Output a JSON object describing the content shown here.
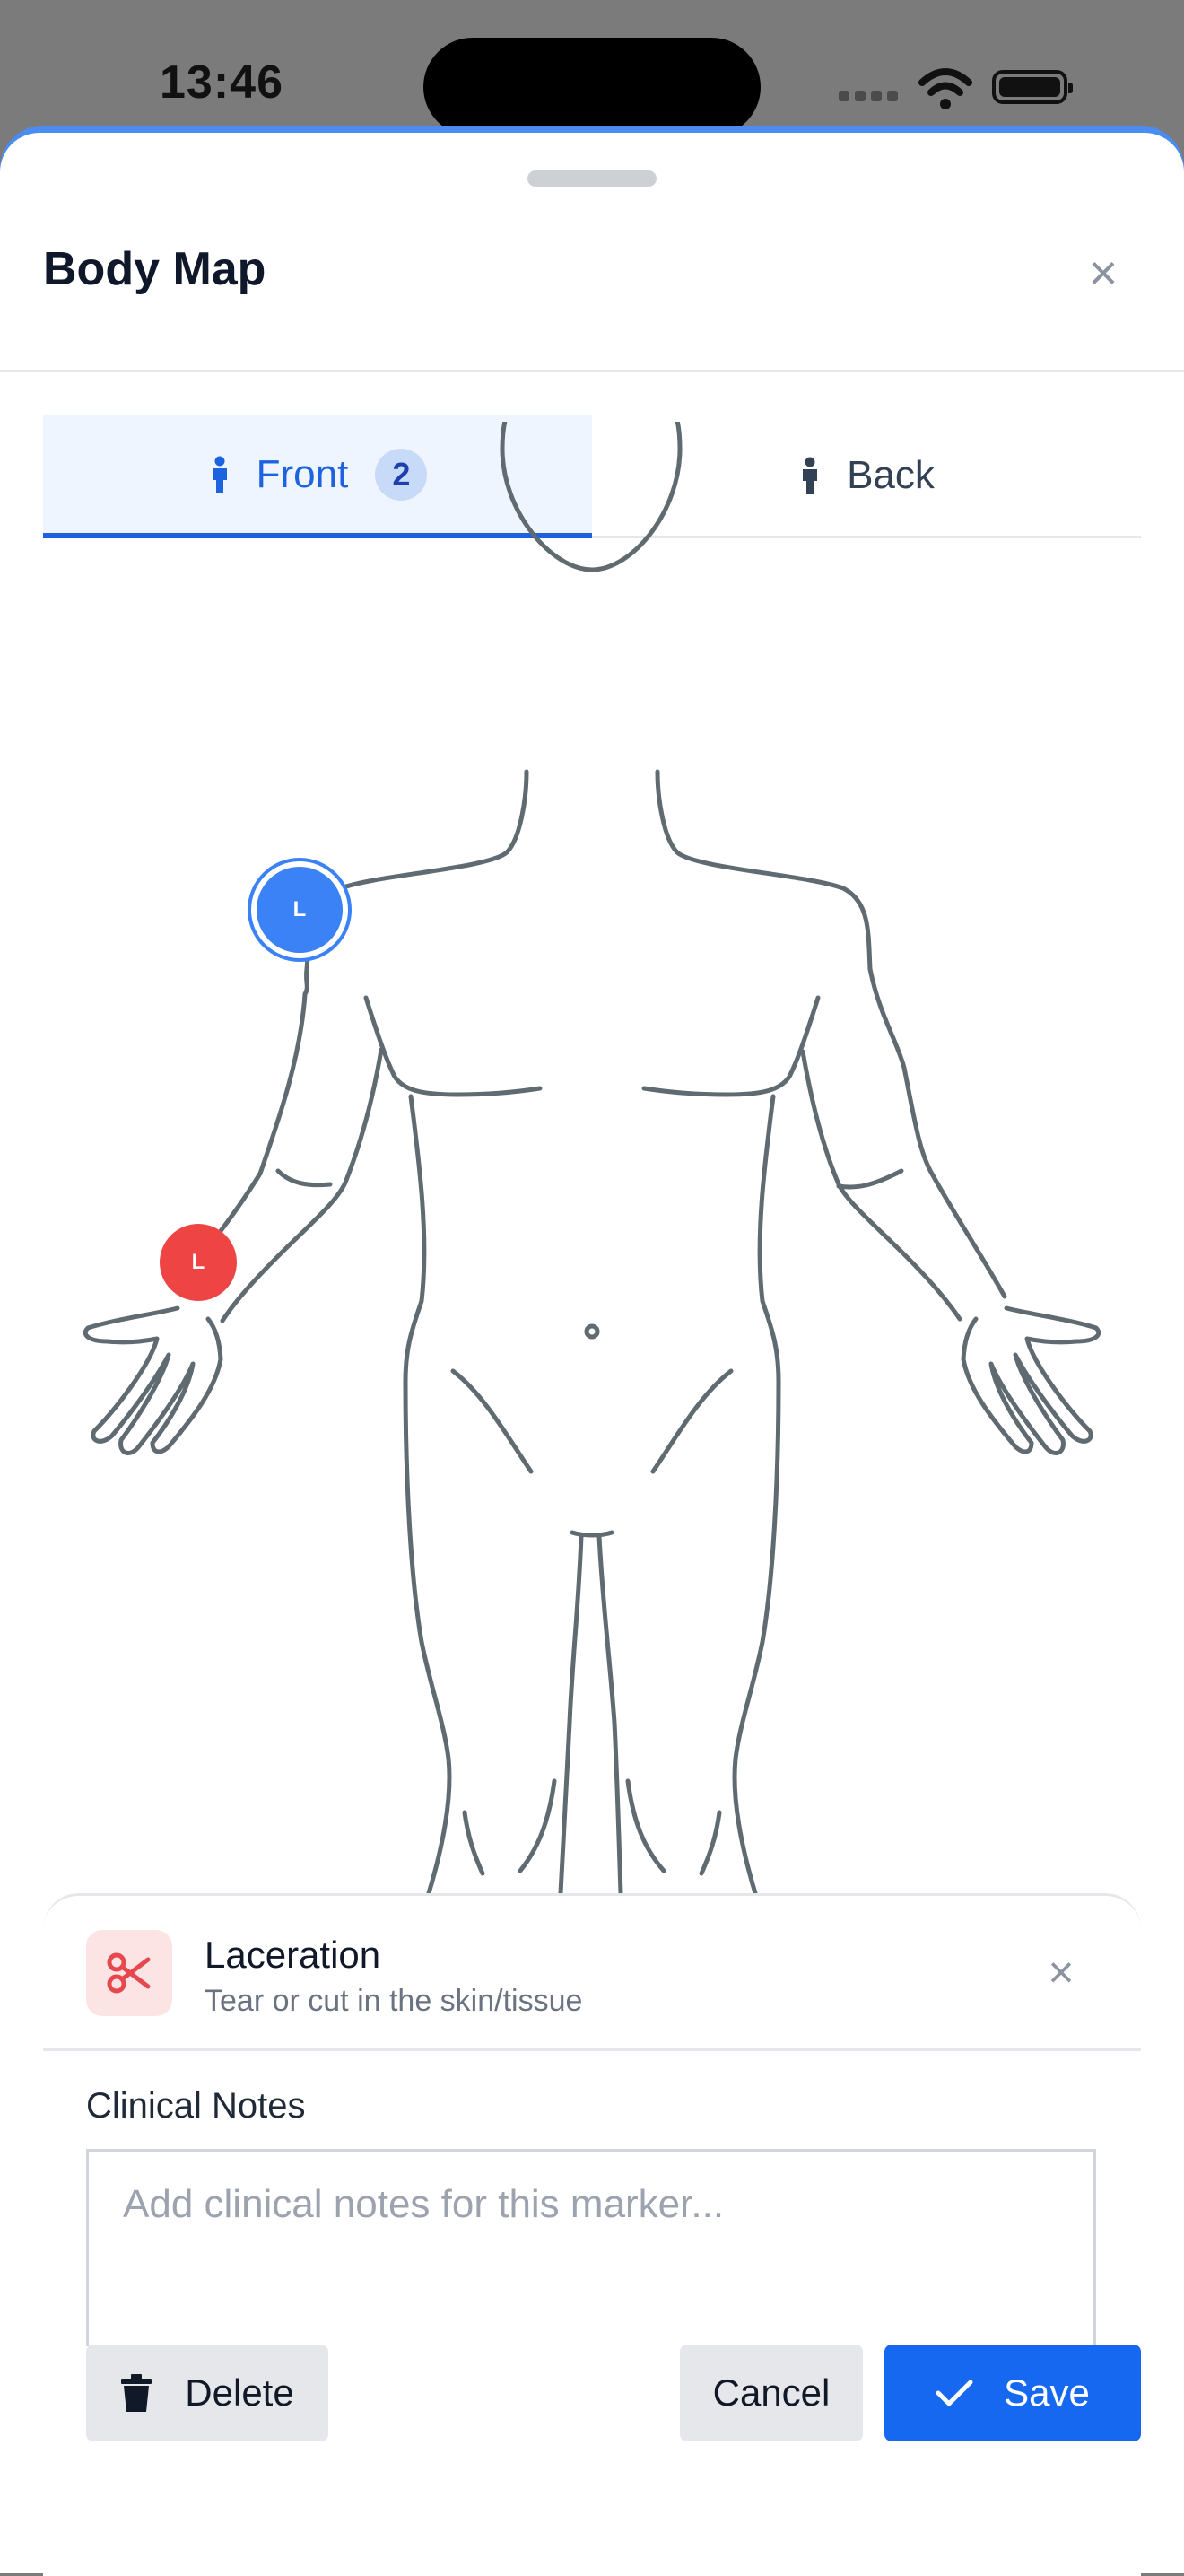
{
  "status_bar": {
    "time": "13:46"
  },
  "sheet": {
    "title": "Body Map"
  },
  "tabs": [
    {
      "label": "Front",
      "count": "2",
      "icon": "person-icon",
      "active": true
    },
    {
      "label": "Back",
      "icon": "person-back-icon",
      "active": false
    }
  ],
  "markers": [
    {
      "label": "L",
      "color": "#3b82f6",
      "selected": true
    },
    {
      "label": "L",
      "color": "#ef4444",
      "selected": false
    }
  ],
  "marker_detail": {
    "type_name": "Laceration",
    "type_description": "Tear or cut in the skin/tissue",
    "icon": "scissors-icon",
    "icon_color": "#e5484d"
  },
  "notes": {
    "label": "Clinical Notes",
    "value": "",
    "placeholder": "Add clinical notes for this marker..."
  },
  "actions": {
    "delete_label": "Delete",
    "cancel_label": "Cancel",
    "save_label": "Save"
  },
  "colors": {
    "accent": "#1668f0",
    "body_outline": "#5f6b70",
    "marker_selected": "#3b82f6",
    "marker_default": "#ef4444"
  }
}
